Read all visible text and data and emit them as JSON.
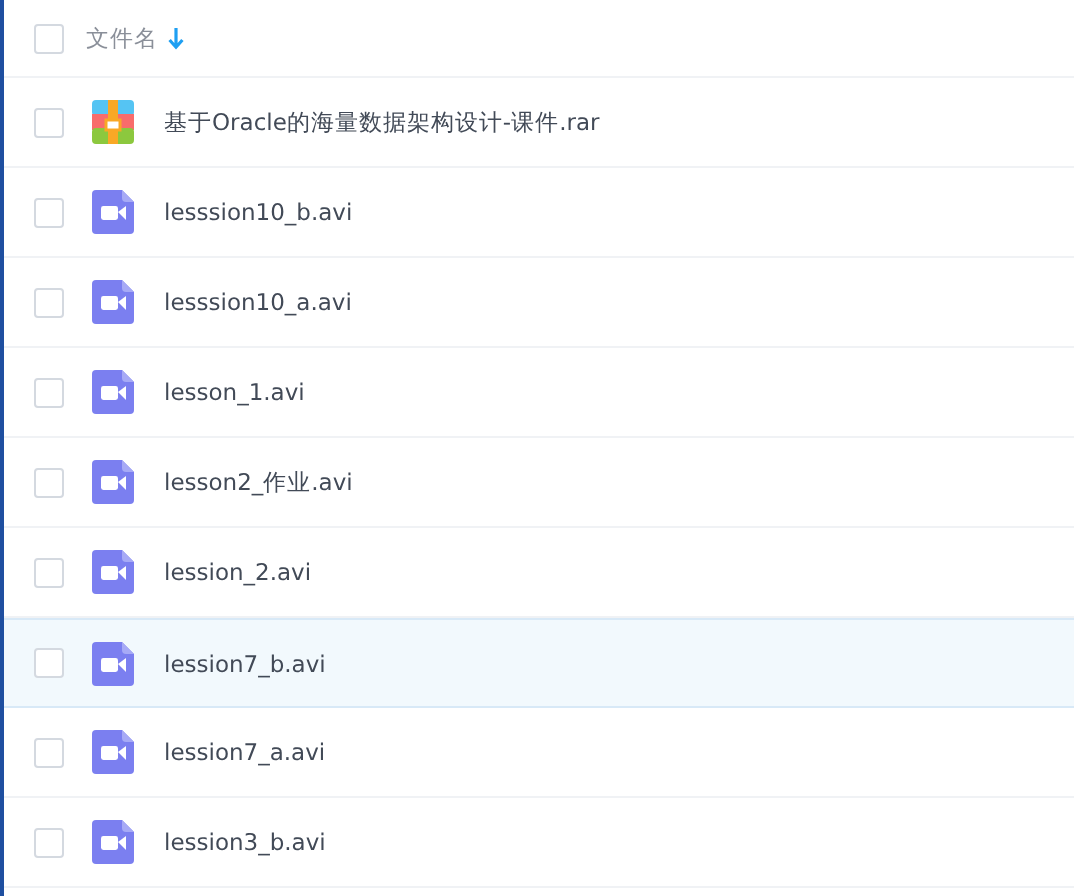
{
  "header": {
    "checked": false,
    "column": "文件名",
    "sort_descending": true
  },
  "files": [
    {
      "name": "基于Oracle的海量数据架构设计-课件.rar",
      "kind": "archive",
      "checked": false,
      "highlighted": false
    },
    {
      "name": "lesssion10_b.avi",
      "kind": "video",
      "checked": false,
      "highlighted": false
    },
    {
      "name": "lesssion10_a.avi",
      "kind": "video",
      "checked": false,
      "highlighted": false
    },
    {
      "name": "lesson_1.avi",
      "kind": "video",
      "checked": false,
      "highlighted": false
    },
    {
      "name": "lesson2_作业.avi",
      "kind": "video",
      "checked": false,
      "highlighted": false
    },
    {
      "name": "lession_2.avi",
      "kind": "video",
      "checked": false,
      "highlighted": false
    },
    {
      "name": "lession7_b.avi",
      "kind": "video",
      "checked": false,
      "highlighted": true
    },
    {
      "name": "lession7_a.avi",
      "kind": "video",
      "checked": false,
      "highlighted": false
    },
    {
      "name": "lession3_b.avi",
      "kind": "video",
      "checked": false,
      "highlighted": false
    }
  ]
}
